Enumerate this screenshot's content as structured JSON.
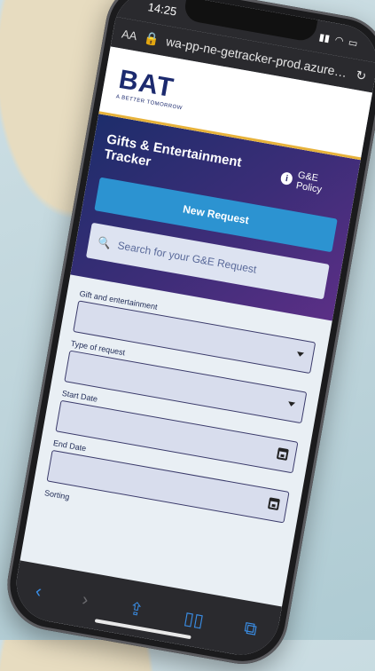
{
  "status_bar": {
    "time": "14:25"
  },
  "browser": {
    "text_size": "AA",
    "url": "wa-pp-ne-getracker-prod.azurewebsit"
  },
  "brand": {
    "logo": "BAT",
    "tagline": "A BETTER TOMORROW"
  },
  "header": {
    "title": "Gifts & Entertainment Tracker",
    "policy_link": "G&E Policy"
  },
  "actions": {
    "new_request": "New Request",
    "search_placeholder": "Search for your G&E Request"
  },
  "form": {
    "fields": [
      {
        "label": "Gift and entertainment",
        "type": "select"
      },
      {
        "label": "Type of request",
        "type": "select"
      },
      {
        "label": "Start Date",
        "type": "date"
      },
      {
        "label": "End Date",
        "type": "date"
      }
    ],
    "partial_label": "Sorting"
  },
  "toolbar": {
    "icons": [
      "back-icon",
      "forward-icon",
      "share-icon",
      "bookmarks-icon",
      "tabs-icon"
    ]
  },
  "colors": {
    "primary": "#1d2d6b",
    "accent": "#2c93d1",
    "brand_line": "#e7b23a"
  }
}
